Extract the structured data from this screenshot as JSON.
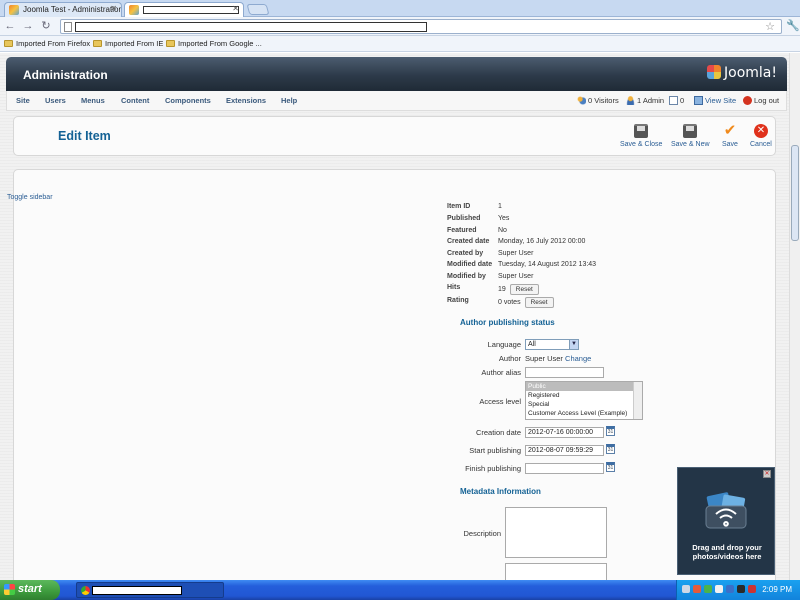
{
  "browser": {
    "tabs": [
      {
        "title": "Joomla Test - Administration"
      },
      {
        "title": ""
      }
    ],
    "bookmarks": [
      "Imported From Firefox",
      "Imported From IE",
      "Imported From Google ..."
    ]
  },
  "admin": {
    "title": "Administration",
    "logo_text": "Joomla!",
    "menu": [
      "Site",
      "Users",
      "Menus",
      "Content",
      "Components",
      "Extensions",
      "Help"
    ],
    "status": {
      "visitors": "0 Visitors",
      "admin": "1 Admin",
      "messages": "0",
      "view_site": "View Site",
      "logout": "Log out"
    }
  },
  "toolbar": {
    "page_title": "Edit Item",
    "buttons": {
      "save_close": "Save & Close",
      "save_new": "Save & New",
      "save": "Save",
      "cancel": "Cancel"
    }
  },
  "content": {
    "toggle_sidebar": "Toggle sidebar",
    "meta": [
      {
        "label": "Item ID",
        "value": "1"
      },
      {
        "label": "Published",
        "value": "Yes"
      },
      {
        "label": "Featured",
        "value": "No"
      },
      {
        "label": "Created date",
        "value": "Monday, 16 July 2012 00:00"
      },
      {
        "label": "Created by",
        "value": "Super User"
      },
      {
        "label": "Modified date",
        "value": "Tuesday, 14 August 2012 13:43"
      },
      {
        "label": "Modified by",
        "value": "Super User"
      },
      {
        "label": "Hits",
        "value": "19"
      },
      {
        "label": "Rating",
        "value": "0 votes"
      }
    ],
    "reset_label": "Reset",
    "author_section": "Author publishing status",
    "language_label": "Language",
    "language_value": "All",
    "author_label": "Author",
    "author_value": "Super User",
    "author_change": "Change",
    "author_alias_label": "Author alias",
    "author_alias_value": "",
    "access_label": "Access level",
    "access_options": [
      "Public",
      "Registered",
      "Special",
      "Customer Access Level (Example)"
    ],
    "creation_label": "Creation date",
    "creation_value": "2012-07-16 00:00:00",
    "start_label": "Start publishing",
    "start_value": "2012-08-07 09:59:29",
    "finish_label": "Finish publishing",
    "finish_value": "",
    "calendar_icon_text": "31",
    "metadata_section": "Metadata Information",
    "description_label": "Description",
    "description_value": ""
  },
  "dnd_widget": {
    "text": "Drag and drop your photos/videos here"
  },
  "taskbar": {
    "start": "start",
    "clock": "2:09 PM"
  }
}
